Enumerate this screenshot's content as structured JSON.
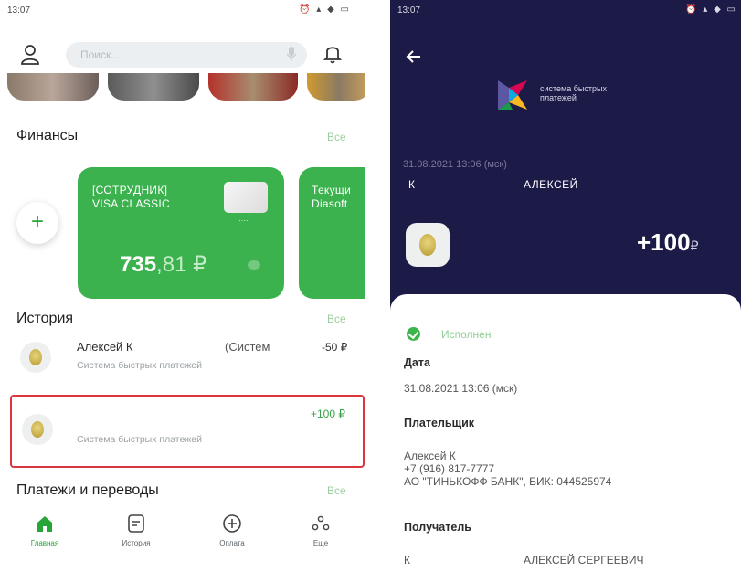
{
  "left": {
    "status": {
      "time": "13:07",
      "icons": "⏰ ▴ ◆ ▭"
    },
    "search": {
      "placeholder": "Поиск..."
    },
    "finance": {
      "title": "Финансы",
      "all": "Все",
      "card": {
        "name_line1": "[СОТРУДНИК]",
        "name_line2": "VISA CLASSIC",
        "mini_num": "····",
        "balance_int": "735",
        "balance_dec": ",81 ₽"
      },
      "card2": {
        "line1": "Текущи",
        "line2": "Diasoft"
      }
    },
    "history": {
      "title": "История",
      "all": "Все",
      "items": [
        {
          "name": "Алексей К",
          "suffix": "(Систем",
          "sub": "Система быстрых платежей",
          "amount": "-50 ₽"
        },
        {
          "name": "",
          "sub": "Система быстрых платежей",
          "amount": "+100 ₽"
        }
      ]
    },
    "payments": {
      "title": "Платежи и переводы",
      "all": "Все"
    },
    "nav": [
      {
        "label": "Главная",
        "icon": "home-icon"
      },
      {
        "label": "История",
        "icon": "history-icon"
      },
      {
        "label": "Оплата",
        "icon": "payment-plus-icon"
      },
      {
        "label": "Еще",
        "icon": "more-icon"
      }
    ]
  },
  "right": {
    "status": {
      "time": "13:07",
      "icons": "⏰ ▴ ◆ ▭"
    },
    "logo_text_line1": "система быстрых",
    "logo_text_line2": "платежей",
    "date": "31.08.2021 13:06 (мск)",
    "sender_letter": "К",
    "sender_name": "АЛЕКСЕЙ",
    "amount": "+100",
    "currency": "₽",
    "status_label": "Исполнен",
    "date_label": "Дата",
    "date_value": "31.08.2021 13:06 (мск)",
    "payer_label": "Плательщик",
    "payer_name": "Алексей К",
    "payer_phone": "+7 (916) 817-7777",
    "payer_bank": "АО \"ТИНЬКОФФ БАНК\", БИК: 044525974",
    "recipient_label": "Получатель",
    "recipient_letter": "К",
    "recipient_name": "АЛЕКСЕЙ СЕРГЕЕВИЧ"
  },
  "colors": {
    "green": "#3cb24f",
    "navy": "#1c1a47",
    "highlight": "#d9363e"
  }
}
